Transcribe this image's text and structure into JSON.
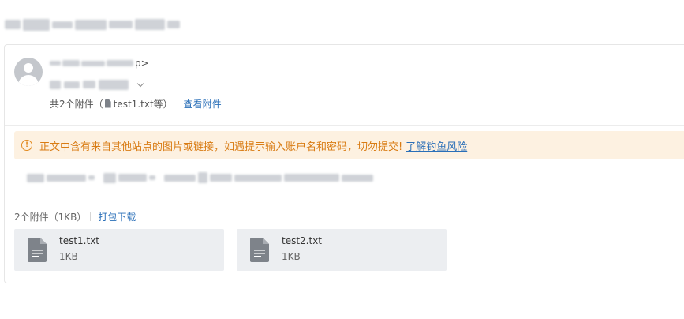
{
  "header": {
    "subject_blurred": true
  },
  "sender": {
    "display_suffix": "p>",
    "recipient_expand_icon": "chevron-down-icon"
  },
  "attachment_summary": {
    "prefix": "共2个附件（",
    "first_file": "test1.txt等）",
    "view_link": "查看附件"
  },
  "warning": {
    "icon": "warning-icon",
    "text": "正文中含有来自其他站点的图片或链接，如遇提示输入账户名和密码，切勿提交!",
    "link": "了解钓鱼风险"
  },
  "attachments": {
    "count_label": "2个附件（1KB）",
    "download_all": "打包下载",
    "items": [
      {
        "name": "test1.txt",
        "size": "1KB",
        "icon": "file-icon"
      },
      {
        "name": "test2.txt",
        "size": "1KB",
        "icon": "file-icon"
      }
    ]
  },
  "colors": {
    "link": "#2a6fb8",
    "warning_text": "#d97c14",
    "warning_bg": "#fdf1e1",
    "attachment_card_bg": "#eceef1"
  }
}
